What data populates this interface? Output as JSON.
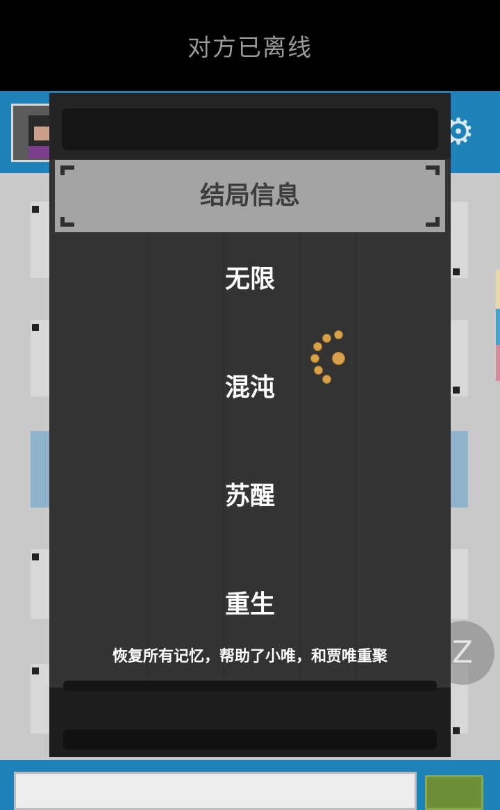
{
  "status_bar": {
    "title": "对方已离线"
  },
  "header": {
    "settings_icon": "gear-icon",
    "avatar": "avatar"
  },
  "dialog": {
    "title": "结局信息",
    "options": [
      "无限",
      "混沌",
      "苏醒",
      "重生"
    ],
    "description": "恢复所有记忆，帮助了小唯，和贾唯重聚"
  },
  "floating_button": {
    "label": "Z"
  },
  "colors": {
    "header_blue": "#1e82b8",
    "modal_bg": "#333333",
    "modal_header": "#a4a4a4",
    "spinner": "#d9a24a"
  }
}
